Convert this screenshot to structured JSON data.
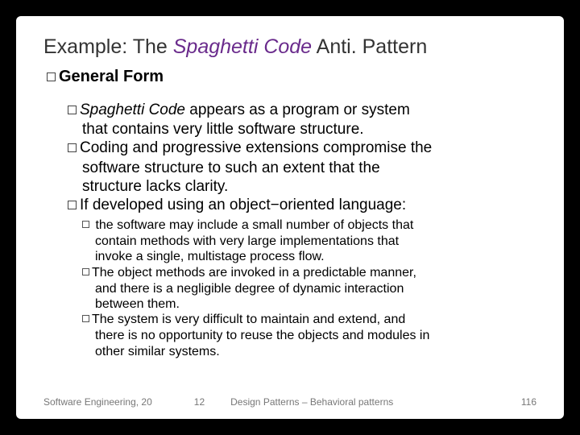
{
  "title_pre": "Example: The ",
  "title_em": "Spaghetti Code",
  "title_post": " Anti. Pattern",
  "h1": "General Form",
  "b1_em": "Spaghetti Code",
  "b1_rest": " appears as a program or system",
  "b1_l2": "that contains very little software structure.",
  "b2_l1": "Coding and progressive extensions compromise the",
  "b2_l2": "software structure to such an extent that the",
  "b2_l3": "structure lacks clarity.",
  "b3_l1": "If developed using an object−oriented language:",
  "s1_l1": " the software may include a small number of objects that",
  "s1_l2": "contain methods with very large implementations that",
  "s1_l3": "invoke a single, multistage process flow.",
  "s2_l1": "The object methods are invoked in a predictable manner,",
  "s2_l2": "and there is a negligible degree of dynamic interaction",
  "s2_l3": "between them.",
  "s3_l1": "The system is very difficult to maintain and extend, and",
  "s3_l2": "there is no opportunity to reuse the objects and modules in",
  "s3_l3": "other similar systems.",
  "footer_left": "Software Engineering, 20",
  "footer_mid1": "12",
  "footer_mid2": "Design Patterns – Behavioral patterns",
  "footer_page": "116"
}
